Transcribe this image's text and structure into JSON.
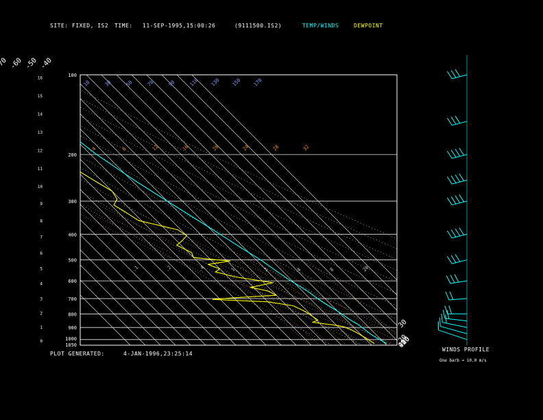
{
  "header": {
    "site_label": "SITE:",
    "site_value": "FIXED, IS2",
    "time_label": "TIME:",
    "time_value": "11-SEP-1995,15:00:26",
    "file_id": "(9111500.IS2)",
    "temp_winds_label": "TEMP/WINDS",
    "dewpoint_label": "DEWPOINT"
  },
  "footer": {
    "plot_generated_label": "PLOT GENERATED:",
    "plot_generated_value": "4-JAN-1996,23:25:14",
    "winds_profile_label": "WINDS PROFILE",
    "barb_scale_note": "One barb = 10.0 m/s"
  },
  "colors": {
    "temperature": "#00ffff",
    "dewpoint": "#ffff00",
    "background": "#000000",
    "axes": "#ffffff",
    "mixing_ratio": "#ff8c00",
    "theta_labels": "#7fa0ff"
  },
  "chart_data": {
    "type": "line",
    "subtype": "skew-T log-P sounding",
    "title": "",
    "pressure_levels_hPa": [
      100,
      200,
      300,
      400,
      500,
      600,
      700,
      800,
      900,
      1000,
      1050
    ],
    "pressure_axis_labels": [
      "100",
      "200",
      "300",
      "400",
      "500",
      "600",
      "700",
      "800",
      "900",
      "1000",
      "1050"
    ],
    "height_km_labels": [
      "0",
      "1",
      "2",
      "3",
      "4",
      "5",
      "6",
      "7",
      "8",
      "9",
      "10",
      "11",
      "12",
      "13",
      "14",
      "15",
      "16"
    ],
    "top_isotherm_labels": [
      "-110",
      "-100",
      "-90",
      "-80",
      "-70",
      "-60",
      "-50",
      "-40"
    ],
    "right_isotherm_labels": [
      "-30",
      "-20",
      "-10",
      "0",
      "10",
      "20",
      "30"
    ],
    "isotherm_step_C": 10,
    "mixing_ratio_labels": [
      ".1",
      ".2",
      ".4",
      "1",
      "2",
      "4",
      "8",
      "20"
    ],
    "mixing_ratio_upper_labels": [
      "4",
      "8",
      "12",
      "16",
      "20",
      "24",
      "28",
      "32"
    ],
    "theta_labels": [
      "10",
      "30",
      "50",
      "70",
      "90",
      "110",
      "130",
      "150",
      "170"
    ],
    "ylim_hPa": [
      1050,
      100
    ],
    "series": [
      {
        "name": "TEMP/WINDS",
        "color": "#00ffff",
        "points": [
          [
            1035,
            11
          ],
          [
            1000,
            9
          ],
          [
            960,
            7
          ],
          [
            920,
            6
          ],
          [
            880,
            5
          ],
          [
            850,
            3
          ],
          [
            800,
            1
          ],
          [
            750,
            -2
          ],
          [
            700,
            -5
          ],
          [
            650,
            -7
          ],
          [
            600,
            -11
          ],
          [
            550,
            -14
          ],
          [
            500,
            -17
          ],
          [
            450,
            -22
          ],
          [
            400,
            -27
          ],
          [
            350,
            -33
          ],
          [
            300,
            -40
          ],
          [
            250,
            -48
          ],
          [
            200,
            -56
          ],
          [
            175,
            -59
          ],
          [
            150,
            -63
          ],
          [
            125,
            -67
          ],
          [
            110,
            -70
          ],
          [
            100,
            -72
          ]
        ]
      },
      {
        "name": "DEWPOINT",
        "color": "#ffff00",
        "points": [
          [
            1035,
            3
          ],
          [
            990,
            1
          ],
          [
            950,
            -1
          ],
          [
            920,
            -3
          ],
          [
            895,
            -6
          ],
          [
            880,
            -12
          ],
          [
            870,
            -18
          ],
          [
            860,
            -24
          ],
          [
            845,
            -19
          ],
          [
            820,
            -20
          ],
          [
            795,
            -21
          ],
          [
            770,
            -23
          ],
          [
            745,
            -26
          ],
          [
            720,
            -40
          ],
          [
            705,
            -75
          ],
          [
            695,
            -60
          ],
          [
            680,
            -30
          ],
          [
            655,
            -33
          ],
          [
            635,
            -42
          ],
          [
            610,
            -24
          ],
          [
            580,
            -45
          ],
          [
            555,
            -55
          ],
          [
            540,
            -50
          ],
          [
            520,
            -55
          ],
          [
            505,
            -38
          ],
          [
            490,
            -60
          ],
          [
            470,
            -58
          ],
          [
            440,
            -63
          ],
          [
            425,
            -57
          ],
          [
            405,
            -50
          ],
          [
            385,
            -52
          ],
          [
            355,
            -72
          ],
          [
            330,
            -75
          ],
          [
            310,
            -78
          ],
          [
            295,
            -72
          ],
          [
            275,
            -70
          ],
          [
            250,
            -75
          ],
          [
            225,
            -80
          ],
          [
            200,
            -85
          ],
          [
            175,
            -88
          ],
          [
            150,
            -91
          ],
          [
            130,
            -92
          ],
          [
            115,
            -94
          ],
          [
            100,
            -97
          ]
        ]
      }
    ],
    "winds_profile": [
      {
        "p": 1000,
        "speed_ms": 12,
        "dir_deg": 230
      },
      {
        "p": 950,
        "speed_ms": 14,
        "dir_deg": 240
      },
      {
        "p": 900,
        "speed_ms": 16,
        "dir_deg": 250
      },
      {
        "p": 850,
        "speed_ms": 18,
        "dir_deg": 260
      },
      {
        "p": 800,
        "speed_ms": 20,
        "dir_deg": 270
      },
      {
        "p": 700,
        "speed_ms": 22,
        "dir_deg": 275
      },
      {
        "p": 600,
        "speed_ms": 25,
        "dir_deg": 280
      },
      {
        "p": 500,
        "speed_ms": 30,
        "dir_deg": 285
      },
      {
        "p": 400,
        "speed_ms": 35,
        "dir_deg": 285
      },
      {
        "p": 300,
        "speed_ms": 40,
        "dir_deg": 285
      },
      {
        "p": 250,
        "speed_ms": 40,
        "dir_deg": 285
      },
      {
        "p": 200,
        "speed_ms": 35,
        "dir_deg": 285
      },
      {
        "p": 150,
        "speed_ms": 30,
        "dir_deg": 285
      },
      {
        "p": 100,
        "speed_ms": 25,
        "dir_deg": 285
      }
    ],
    "grid": true,
    "legend": "top"
  }
}
